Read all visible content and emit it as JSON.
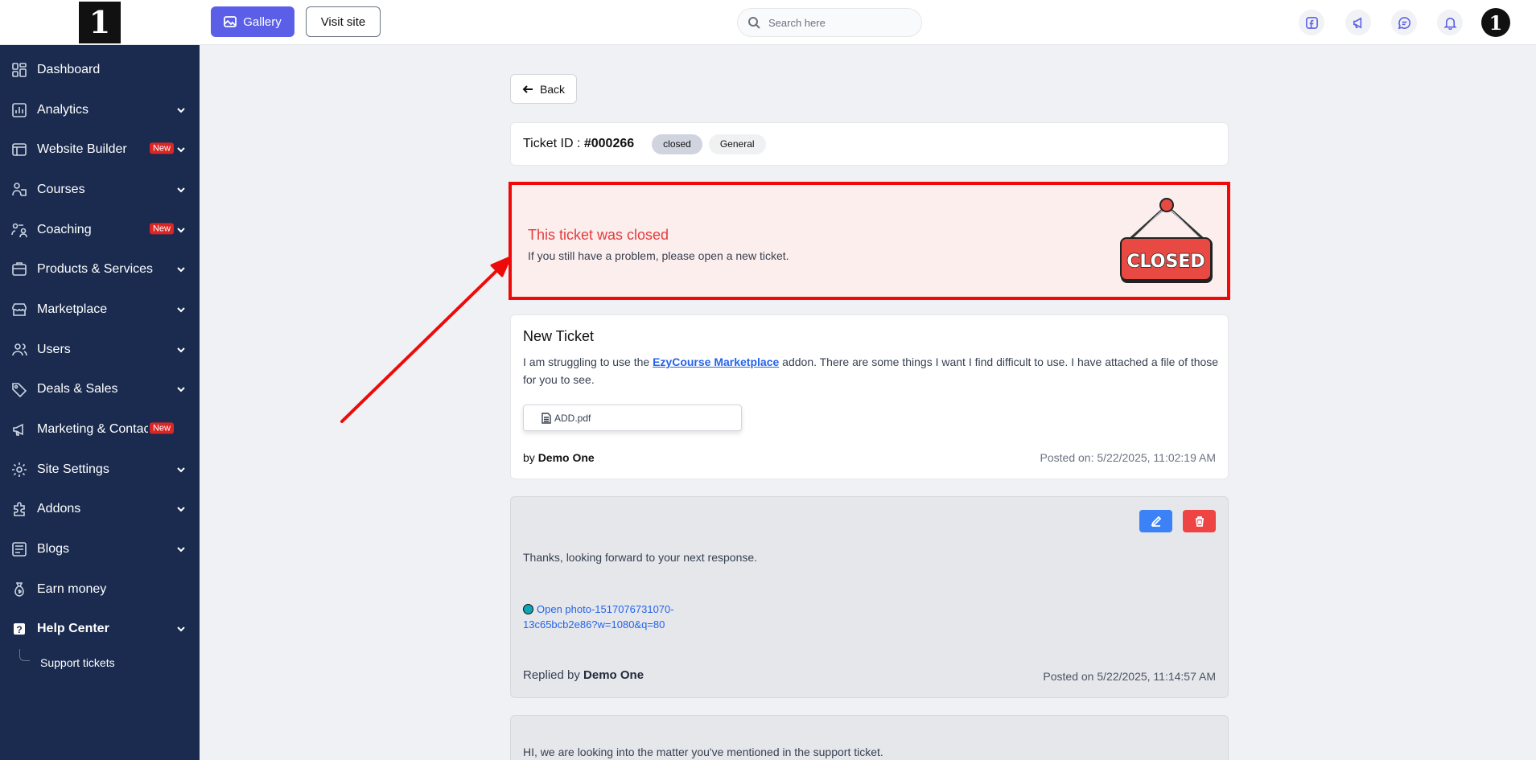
{
  "sidebar": {
    "items": [
      {
        "label": "Dashboard",
        "icon": "dashboard-icon",
        "chevron": false
      },
      {
        "label": "Analytics",
        "icon": "analytics-icon",
        "chevron": true
      },
      {
        "label": "Website Builder",
        "icon": "website-builder-icon",
        "chevron": true,
        "badge": "New"
      },
      {
        "label": "Courses",
        "icon": "courses-icon",
        "chevron": true
      },
      {
        "label": "Coaching",
        "icon": "coaching-icon",
        "chevron": true,
        "badge": "New"
      },
      {
        "label": "Products & Services",
        "icon": "products-icon",
        "chevron": true
      },
      {
        "label": "Marketplace",
        "icon": "marketplace-icon",
        "chevron": true
      },
      {
        "label": "Users",
        "icon": "users-icon",
        "chevron": true
      },
      {
        "label": "Deals & Sales",
        "icon": "tag-icon",
        "chevron": true
      },
      {
        "label": "Marketing & Contacts",
        "icon": "megaphone-icon",
        "chevron": true,
        "badge": "New"
      },
      {
        "label": "Site Settings",
        "icon": "gear-icon",
        "chevron": true
      },
      {
        "label": "Addons",
        "icon": "addons-icon",
        "chevron": true
      },
      {
        "label": "Blogs",
        "icon": "blogs-icon",
        "chevron": true
      },
      {
        "label": "Earn money",
        "icon": "money-bag-icon",
        "chevron": false
      },
      {
        "label": "Help Center",
        "icon": "help-icon",
        "chevron": true
      }
    ],
    "sub_items": [
      "Support tickets"
    ]
  },
  "topbar": {
    "gallery_label": "Gallery",
    "visit_label": "Visit site",
    "search_placeholder": "Search here"
  },
  "main": {
    "back_label": "Back",
    "ticket_id_label": "Ticket ID : ",
    "ticket_id": "#000266",
    "status": "closed",
    "category": "General",
    "closed_banner": {
      "title": "This ticket was closed",
      "subtitle": "If you still have a problem, please open a new ticket.",
      "sign_text": "CLOSED"
    },
    "ticket": {
      "title": "New Ticket",
      "body_before": "I am struggling to use the ",
      "body_link": "EzyCourse Marketplace",
      "body_after": " addon. There are some things I want I find difficult to use. I have attached a file of those for you to see.",
      "attachment": "ADD.pdf",
      "by_prefix": "by ",
      "author": "Demo One",
      "posted": "Posted on: 5/22/2025, 11:02:19 AM"
    },
    "replies": [
      {
        "text": "Thanks, looking forward to your next response.",
        "link_line1": "Open photo-1517076731070-",
        "link_line2": "13c65bcb2e86?w=1080&q=80",
        "by_prefix": "Replied by ",
        "author": "Demo One",
        "posted": "Posted on 5/22/2025, 11:14:57 AM"
      },
      {
        "text": "HI, we are looking into the matter you've mentioned in the support ticket."
      }
    ]
  },
  "colors": {
    "sidebar_bg": "#1a2b4f",
    "accent": "#5b5fe8",
    "closed_border": "#ef0a0a",
    "closed_text": "#e43c3c",
    "annotation_arrow": "#ef0a0a"
  }
}
